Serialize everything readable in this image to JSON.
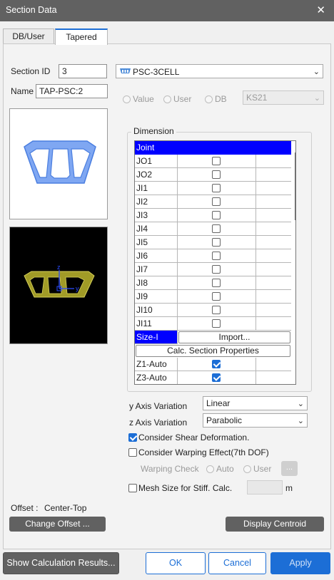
{
  "window": {
    "title": "Section Data",
    "close_glyph": "✕"
  },
  "tabs": [
    {
      "label": "DB/User"
    },
    {
      "label": "Tapered"
    }
  ],
  "section": {
    "id_label": "Section ID",
    "id_value": "3",
    "name_label": "Name",
    "name_value": "TAP-PSC:2",
    "type_value": "PSC-3CELL",
    "type_icon": "psc-3cell-section-icon"
  },
  "source": {
    "value_label": "Value",
    "user_label": "User",
    "db_label": "DB",
    "db_select": "KS21"
  },
  "preview": {
    "axis_z": "z",
    "axis_y": "y",
    "section_color": "#7fa7f2",
    "model_color": "#a19b27"
  },
  "dimension": {
    "title": "Dimension",
    "header": "Joint",
    "rows": [
      {
        "name": "JO1",
        "checked": false
      },
      {
        "name": "JO2",
        "checked": false
      },
      {
        "name": "JI1",
        "checked": false
      },
      {
        "name": "JI2",
        "checked": false
      },
      {
        "name": "JI3",
        "checked": false
      },
      {
        "name": "JI4",
        "checked": false
      },
      {
        "name": "JI5",
        "checked": false
      },
      {
        "name": "JI6",
        "checked": false
      },
      {
        "name": "JI7",
        "checked": false
      },
      {
        "name": "JI8",
        "checked": false
      },
      {
        "name": "JI9",
        "checked": false
      },
      {
        "name": "JI10",
        "checked": false
      },
      {
        "name": "JI11",
        "checked": false
      }
    ],
    "size_label": "Size-I",
    "import_label": "Import...",
    "calc_label": "Calc. Section Properties",
    "z1_label": "Z1-Auto",
    "z1_checked": true,
    "z3_label": "Z3-Auto",
    "z3_checked": true
  },
  "variation": {
    "y_label": "y Axis Variation",
    "y_value": "Linear",
    "z_label": "z Axis Variation",
    "z_value": "Parabolic"
  },
  "options": {
    "shear_label": "Consider Shear Deformation.",
    "shear_checked": true,
    "warping_label": "Consider Warping Effect(7th DOF)",
    "warping_checked": false,
    "warping_check_label": "Warping Check",
    "warping_auto_label": "Auto",
    "warping_user_label": "User",
    "warping_btn": "...",
    "mesh_label": "Mesh Size for Stiff. Calc.",
    "mesh_checked": false,
    "mesh_value": "",
    "mesh_unit": "m"
  },
  "offset": {
    "label": "Offset :",
    "value": "Center-Top",
    "change_btn": "Change Offset ...",
    "centroid_btn": "Display Centroid"
  },
  "footer": {
    "calc_results": "Show Calculation Results...",
    "ok": "OK",
    "cancel": "Cancel",
    "apply": "Apply"
  },
  "colors": {
    "accent": "#1c6ed6",
    "header_blue": "#0000ff",
    "titlebar": "#616161"
  }
}
